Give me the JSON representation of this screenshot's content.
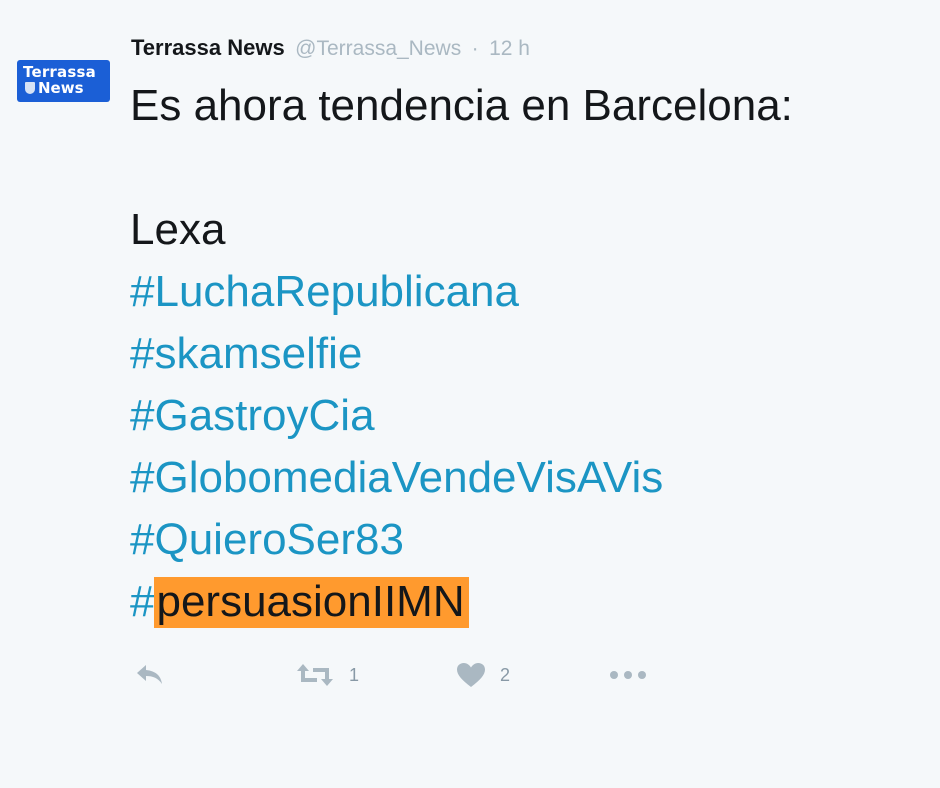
{
  "avatar": {
    "line1": "Terrassa",
    "line2": "News",
    "color": "#1b5fd6"
  },
  "tweet": {
    "author_name": "Terrassa News",
    "handle": "@Terrassa_News",
    "separator": "·",
    "time": "12 h",
    "intro": "Es ahora tendencia en Barcelona:",
    "trend_plain": "Lexa",
    "hashtags": [
      "#LuchaRepublicana",
      "#skamselfie",
      "#GastroyCia",
      "#GlobomediaVendeVisAVis",
      "#QuieroSer83"
    ],
    "last_hashtag_symbol": "#",
    "last_hashtag_word": "persuasionIIMN"
  },
  "actions": {
    "reply_icon": "reply-icon",
    "retweet_icon": "retweet-icon",
    "retweet_count": "1",
    "like_icon": "heart-icon",
    "like_count": "2",
    "more_icon": "more-dots-icon"
  },
  "colors": {
    "background": "#f5f8fa",
    "hashtag": "#1b95c4",
    "highlight": "#ff9a2e",
    "action_icon": "#aab8c2"
  }
}
